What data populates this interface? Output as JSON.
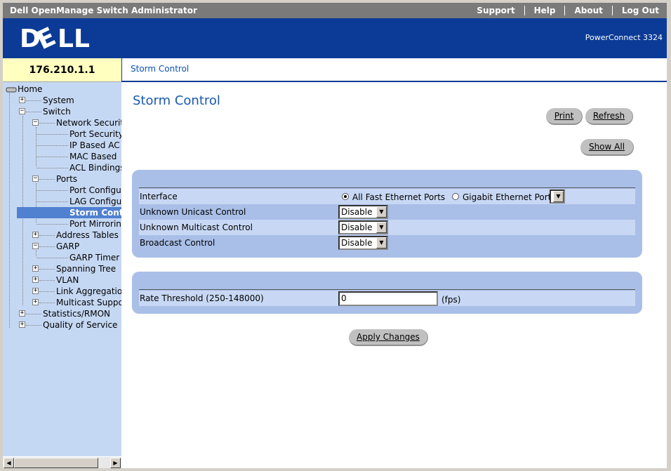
{
  "topbar": {
    "title": "Dell OpenManage Switch Administrator",
    "links": [
      "Support",
      "Help",
      "About",
      "Log Out"
    ]
  },
  "banner": {
    "logo_text": "DELL",
    "product": "PowerConnect 3324"
  },
  "device_ip": "176.210.1.1",
  "breadcrumb": "Storm Control",
  "tree": [
    {
      "label": "Home"
    },
    {
      "label": "System"
    },
    {
      "label": "Switch"
    },
    {
      "label": "Network Securit"
    },
    {
      "label": "Port Security"
    },
    {
      "label": "IP Based AC"
    },
    {
      "label": "MAC Based"
    },
    {
      "label": "ACL Bindings"
    },
    {
      "label": "Ports"
    },
    {
      "label": "Port Configur"
    },
    {
      "label": "LAG Configu"
    },
    {
      "label": "Storm Contr"
    },
    {
      "label": "Port Mirroring"
    },
    {
      "label": "Address Tables"
    },
    {
      "label": "GARP"
    },
    {
      "label": "GARP Timer"
    },
    {
      "label": "Spanning Tree"
    },
    {
      "label": "VLAN"
    },
    {
      "label": "Link Aggregation"
    },
    {
      "label": "Multicast Suppo"
    },
    {
      "label": "Statistics/RMON"
    },
    {
      "label": "Quality of Service"
    }
  ],
  "main": {
    "title": "Storm Control",
    "buttons": {
      "print": "Print",
      "refresh": "Refresh",
      "show_all": "Show All",
      "apply": "Apply Changes"
    },
    "form": {
      "interface_label": "Interface",
      "radio_fast": "All Fast Ethernet Ports",
      "radio_gigabit": "Gigabit Ethernet Port",
      "unicast_label": "Unknown Unicast Control",
      "unicast_value": "Disable",
      "multicast_label": "Unknown Multicast Control",
      "multicast_value": "Disable",
      "broadcast_label": "Broadcast Control",
      "broadcast_value": "Disable",
      "rate_label": "Rate Threshold (250-148000)",
      "rate_value": "0",
      "rate_unit": "(fps)"
    }
  }
}
